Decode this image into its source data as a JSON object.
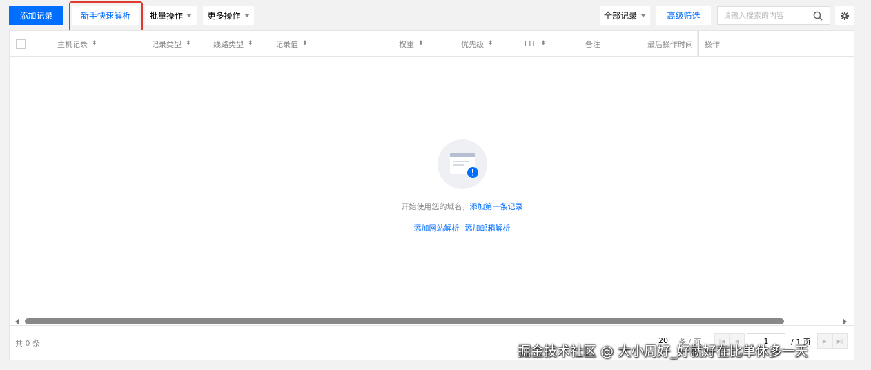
{
  "toolbar": {
    "add_record": "添加记录",
    "quick_resolve": "新手快速解析",
    "batch_ops": "批量操作",
    "more_ops": "更多操作",
    "all_records": "全部记录",
    "advanced_filter": "高级筛选",
    "search_placeholder": "请输入搜索的内容"
  },
  "table": {
    "columns": [
      "主机记录",
      "记录类型",
      "线路类型",
      "记录值",
      "权重",
      "优先级",
      "TTL",
      "备注",
      "最后操作时间",
      "操作"
    ]
  },
  "empty_state": {
    "prefix": "开始使用您的域名，",
    "add_first": "添加第一条记录",
    "add_site": "添加网站解析",
    "add_mail": "添加邮箱解析"
  },
  "footer": {
    "total": "共 0 条",
    "page_size": "20",
    "page_unit": "条 / 页",
    "current_page": "1",
    "total_pages": "/ 1 页"
  },
  "watermark": "掘金技术社区 @ 大小周好_好就好在比单休多一天",
  "colors": {
    "primary": "#006eff",
    "highlight": "#e03a2f"
  }
}
